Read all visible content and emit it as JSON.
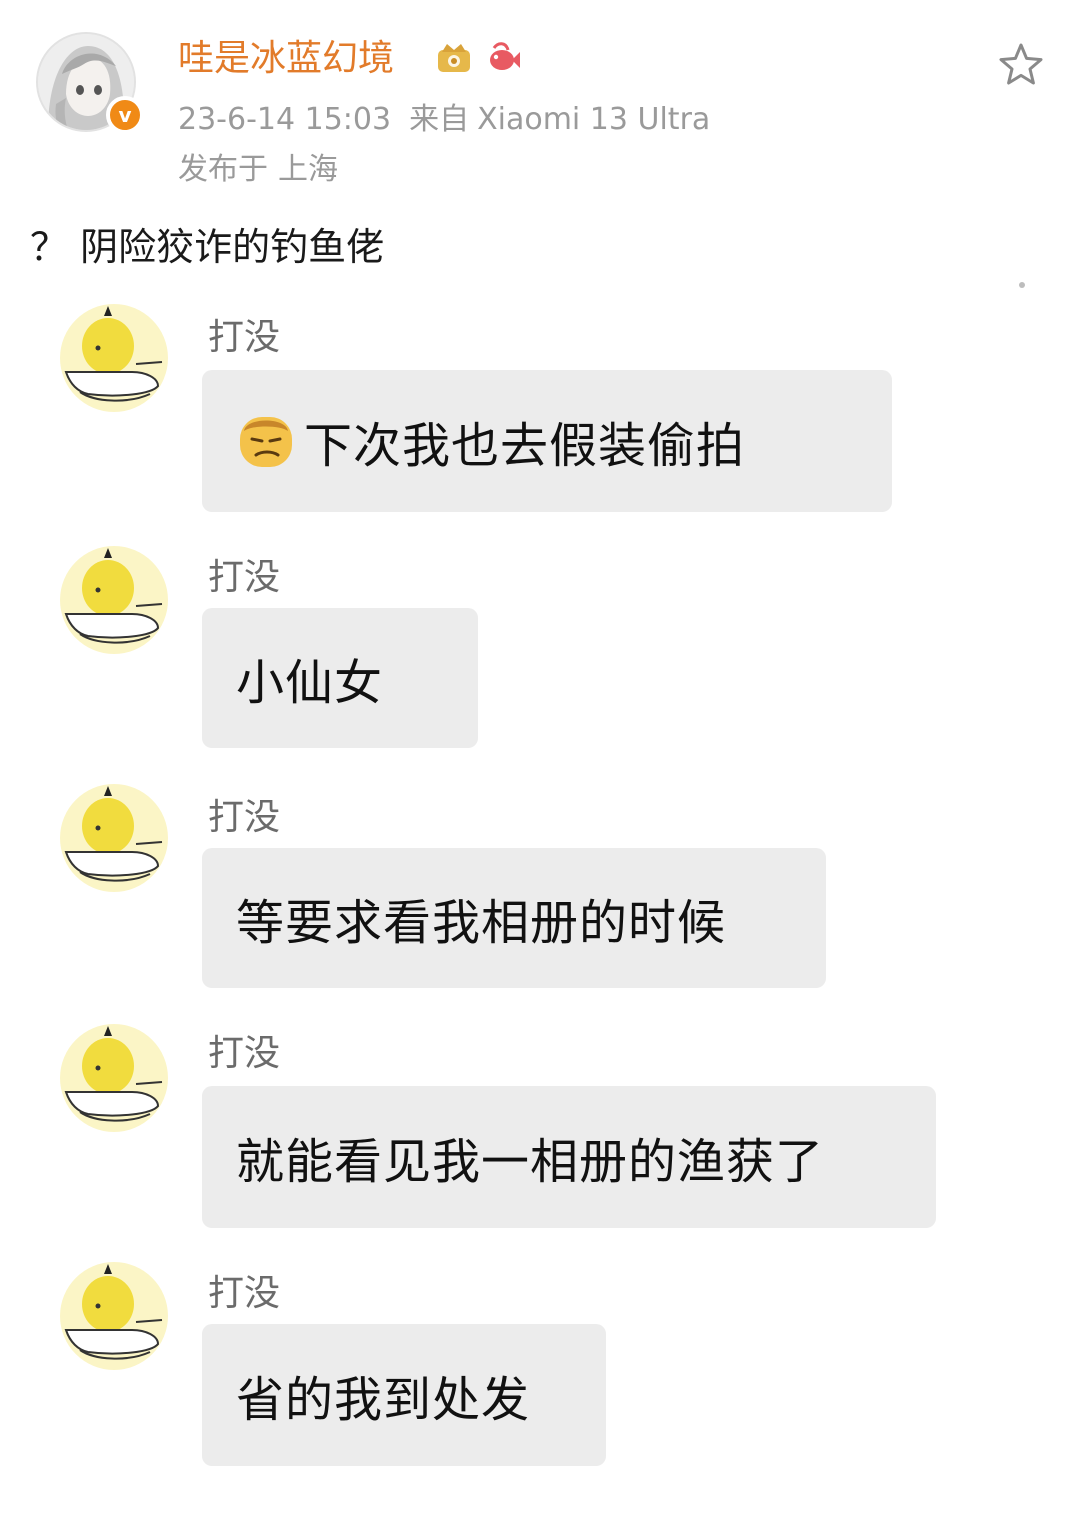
{
  "post": {
    "author": "哇是冰蓝幻境",
    "badges": [
      "vip-crown-icon",
      "koi-fish-icon"
    ],
    "time": "23-6-14 15:03",
    "from_label": "来自",
    "device": "Xiaomi 13 Ultra",
    "location_label": "发布于",
    "location": "上海",
    "text": "？ 阴险狡诈的钓鱼佬",
    "colors": {
      "author_name": "#e27b2a",
      "verified_badge": "#f08a16",
      "meta_text": "#9a9a9a",
      "bubble_bg": "#ececec"
    }
  },
  "chat": {
    "messages": [
      {
        "sender": "打没",
        "text": "下次我也去假装偷拍",
        "emoji": "smirking-face-emoji"
      },
      {
        "sender": "打没",
        "text": "小仙女"
      },
      {
        "sender": "打没",
        "text": "等要求看我相册的时候"
      },
      {
        "sender": "打没",
        "text": "就能看见我一相册的渔获了"
      },
      {
        "sender": "打没",
        "text": "省的我到处发"
      }
    ]
  }
}
